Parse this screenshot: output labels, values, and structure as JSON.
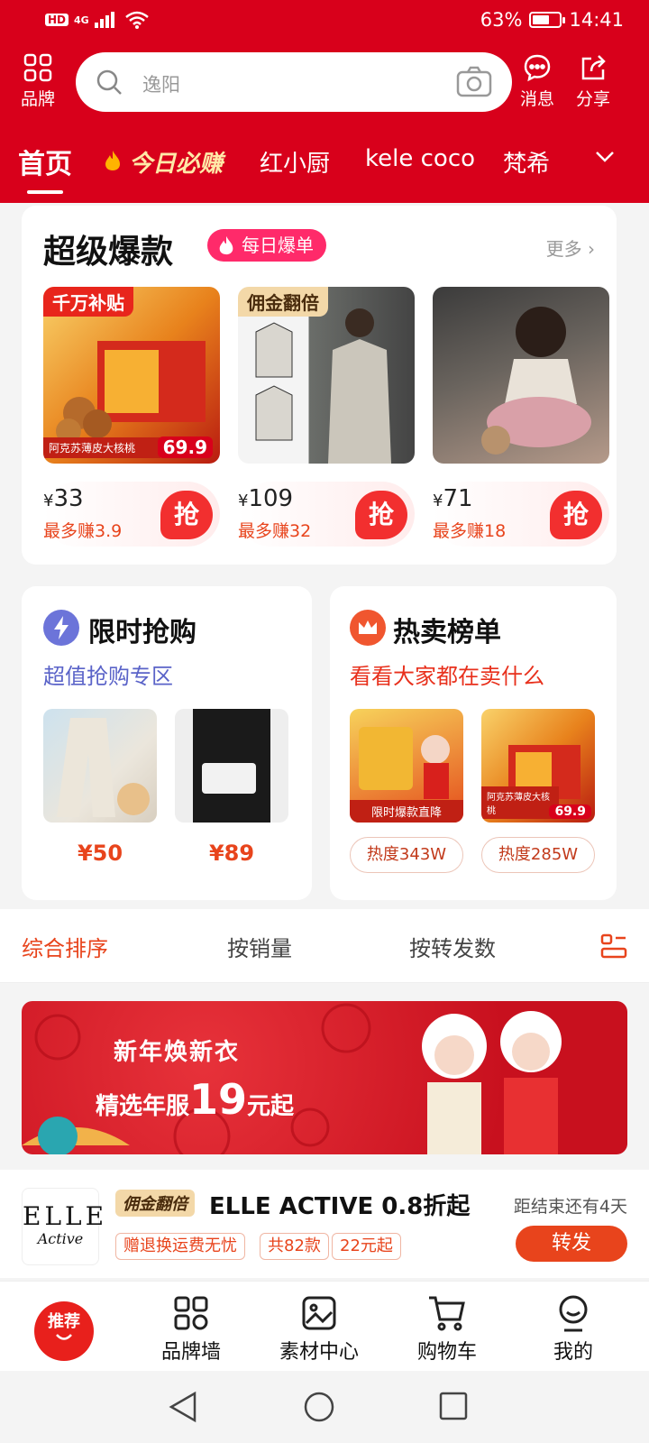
{
  "status": {
    "network": "4G",
    "battery": "63%",
    "time": "14:41",
    "hd": "HD"
  },
  "header": {
    "brand_label": "品牌",
    "search_placeholder": "逸阳",
    "message_label": "消息",
    "share_label": "分享"
  },
  "tabs": [
    "首页",
    "今日必赚",
    "红小厨",
    "kele coco",
    "梵希"
  ],
  "super": {
    "title": "超级爆款",
    "badge": "每日爆单",
    "more": "更多",
    "products": [
      {
        "tag": "千万补贴",
        "price": "33",
        "earn": "最多赚3.9",
        "img_price": "69.9",
        "img_caption": "阿克苏薄皮大核桃",
        "grab": "抢"
      },
      {
        "tag": "佣金翻倍",
        "price": "109",
        "earn": "最多赚32",
        "grab": "抢"
      },
      {
        "tag": "",
        "price": "71",
        "earn": "最多赚18",
        "grab": "抢"
      }
    ]
  },
  "flash": {
    "title": "限时抢购",
    "subtitle": "超值抢购专区",
    "items": [
      {
        "price": "¥50"
      },
      {
        "price": "¥89"
      }
    ]
  },
  "hot": {
    "title": "热卖榜单",
    "subtitle": "看看大家都在卖什么",
    "items": [
      {
        "heat": "热度343W",
        "caption": "限时爆款直降"
      },
      {
        "heat": "热度285W",
        "caption": "阿克苏薄皮大核桃",
        "img_price": "69.9"
      }
    ]
  },
  "sort": {
    "options": [
      "综合排序",
      "按销量",
      "按转发数"
    ]
  },
  "banner": {
    "line1": "新年焕新衣",
    "line2_prefix": "精选年服",
    "line2_number": "19",
    "line2_suffix": "元起"
  },
  "brand": {
    "logo_line1": "ELLE",
    "logo_line2": "Active",
    "tag": "佣金翻倍",
    "title": "ELLE ACTIVE 0.8折起",
    "chips": [
      "赠退换运费无忧",
      "共82款",
      "22元起"
    ],
    "countdown": "距结束还有4天",
    "forward": "转发"
  },
  "bottom_nav": {
    "recommend": "推荐",
    "items": [
      "品牌墙",
      "素材中心",
      "购物车",
      "我的"
    ]
  },
  "colors": {
    "primary": "#d8001b",
    "accent": "#e8441c",
    "pink": "#ff2a6a",
    "flash_sub": "#5a63c8"
  }
}
